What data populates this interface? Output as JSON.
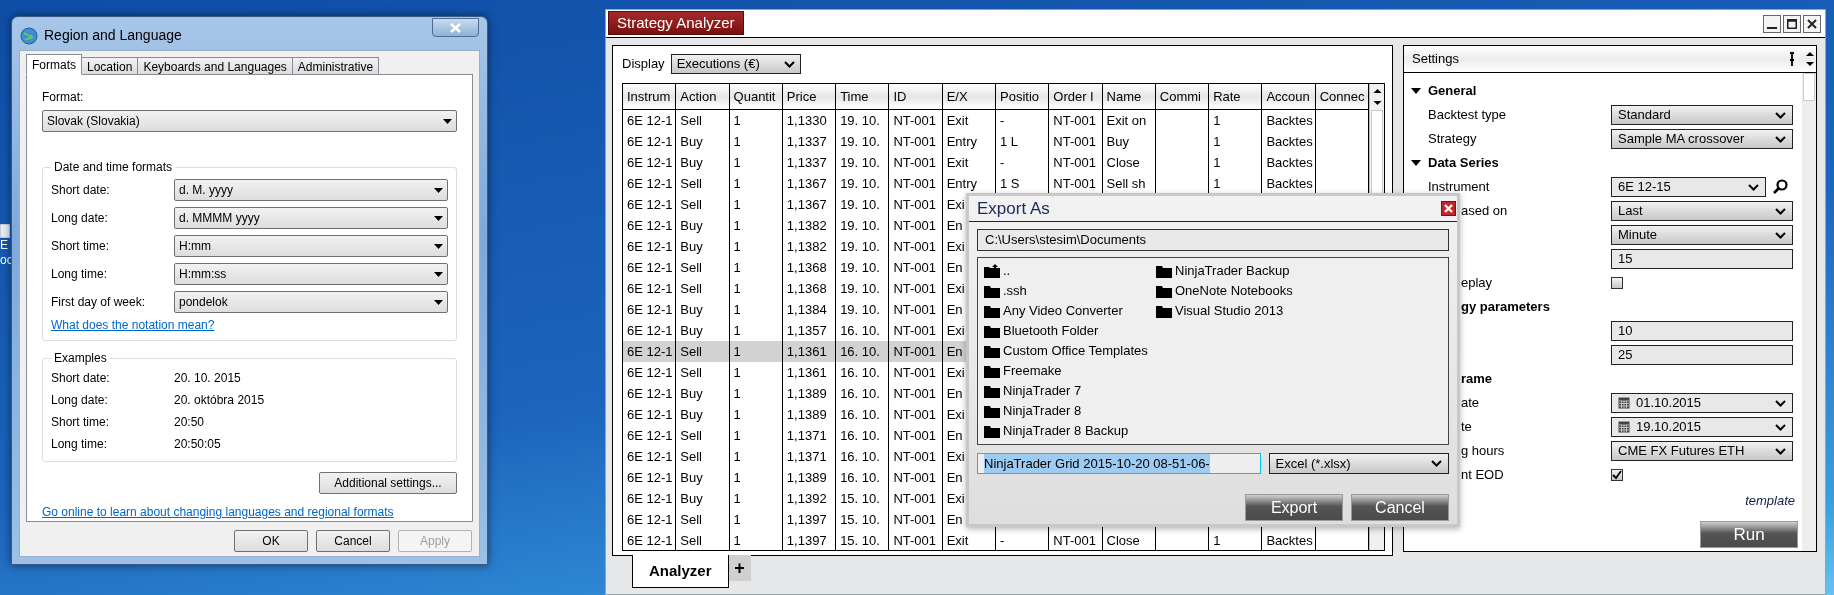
{
  "desktop": {
    "icon_label_lines": [
      "E",
      "oc"
    ]
  },
  "region_dialog": {
    "title": "Region and Language",
    "tabs": [
      {
        "label": "Formats",
        "selected": true
      },
      {
        "label": "Location",
        "selected": false
      },
      {
        "label": "Keyboards and Languages",
        "selected": false
      },
      {
        "label": "Administrative",
        "selected": false
      }
    ],
    "format_label": "Format:",
    "format_value": "Slovak (Slovakia)",
    "formats_group": {
      "title": "Date and time formats",
      "rows": [
        {
          "label": "Short date:",
          "value": "d. M. yyyy"
        },
        {
          "label": "Long date:",
          "value": "d. MMMM yyyy"
        },
        {
          "label": "Short time:",
          "value": "H:mm"
        },
        {
          "label": "Long time:",
          "value": "H:mm:ss"
        },
        {
          "label": "First day of week:",
          "value": "pondelok"
        }
      ],
      "link": "What does the notation mean?"
    },
    "examples_group": {
      "title": "Examples",
      "rows": [
        {
          "label": "Short date:",
          "value": "20. 10. 2015"
        },
        {
          "label": "Long date:",
          "value": "20. októbra 2015"
        },
        {
          "label": "Short time:",
          "value": "20:50"
        },
        {
          "label": "Long time:",
          "value": "20:50:05"
        }
      ]
    },
    "additional_button": "Additional settings...",
    "online_link": "Go online to learn about changing languages and regional formats",
    "buttons": [
      {
        "label": "OK",
        "disabled": false
      },
      {
        "label": "Cancel",
        "disabled": false
      },
      {
        "label": "Apply",
        "disabled": true
      }
    ]
  },
  "strategy_window": {
    "title": "Strategy Analyzer",
    "display_label": "Display",
    "display_value": "Executions (€)",
    "table": {
      "columns": [
        "Instrum",
        "Action",
        "Quantit",
        "Price",
        "Time",
        "ID",
        "E/X",
        "Positio",
        "Order I",
        "Name",
        "Commi",
        "Rate",
        "Accoun",
        "Connec"
      ],
      "rows": [
        {
          "selected": false,
          "cells": [
            "6E 12-1",
            "Sell",
            "1",
            "1,1330",
            "19. 10.",
            "NT-001",
            "Exit",
            "-",
            "NT-001",
            "Exit on",
            null,
            "1",
            "Backtes"
          ]
        },
        {
          "selected": false,
          "cells": [
            "6E 12-1",
            "Buy",
            "1",
            "1,1337",
            "19. 10.",
            "NT-001",
            "Entry",
            "1 L",
            "NT-001",
            "Buy",
            null,
            "1",
            "Backtes"
          ]
        },
        {
          "selected": false,
          "cells": [
            "6E 12-1",
            "Buy",
            "1",
            "1,1337",
            "19. 10.",
            "NT-001",
            "Exit",
            "-",
            "NT-001",
            "Close",
            null,
            "1",
            "Backtes"
          ]
        },
        {
          "selected": false,
          "cells": [
            "6E 12-1",
            "Sell",
            "1",
            "1,1367",
            "19. 10.",
            "NT-001",
            "Entry",
            "1 S",
            "NT-001",
            "Sell sh",
            null,
            "1",
            "Backtes"
          ]
        },
        {
          "selected": false,
          "cells": [
            "6E 12-1",
            "Sell",
            "1",
            "1,1367",
            "19. 10.",
            "NT-001",
            "Exi"
          ]
        },
        {
          "selected": false,
          "cells": [
            "6E 12-1",
            "Buy",
            "1",
            "1,1382",
            "19. 10.",
            "NT-001",
            "En"
          ]
        },
        {
          "selected": false,
          "cells": [
            "6E 12-1",
            "Buy",
            "1",
            "1,1382",
            "19. 10.",
            "NT-001",
            "Exi"
          ]
        },
        {
          "selected": false,
          "cells": [
            "6E 12-1",
            "Sell",
            "1",
            "1,1368",
            "19. 10.",
            "NT-001",
            "En"
          ]
        },
        {
          "selected": false,
          "cells": [
            "6E 12-1",
            "Sell",
            "1",
            "1,1368",
            "19. 10.",
            "NT-001",
            "Exi"
          ]
        },
        {
          "selected": false,
          "cells": [
            "6E 12-1",
            "Buy",
            "1",
            "1,1384",
            "19. 10.",
            "NT-001",
            "En"
          ]
        },
        {
          "selected": false,
          "cells": [
            "6E 12-1",
            "Buy",
            "1",
            "1,1357",
            "16. 10.",
            "NT-001",
            "Exi"
          ]
        },
        {
          "selected": true,
          "cells": [
            "6E 12-1",
            "Sell",
            "1",
            "1,1361",
            "16. 10.",
            "NT-001",
            "En"
          ]
        },
        {
          "selected": false,
          "cells": [
            "6E 12-1",
            "Sell",
            "1",
            "1,1361",
            "16. 10.",
            "NT-001",
            "Exi"
          ]
        },
        {
          "selected": false,
          "cells": [
            "6E 12-1",
            "Buy",
            "1",
            "1,1389",
            "16. 10.",
            "NT-001",
            "En"
          ]
        },
        {
          "selected": false,
          "cells": [
            "6E 12-1",
            "Buy",
            "1",
            "1,1389",
            "16. 10.",
            "NT-001",
            "Exi"
          ]
        },
        {
          "selected": false,
          "cells": [
            "6E 12-1",
            "Sell",
            "1",
            "1,1371",
            "16. 10.",
            "NT-001",
            "En"
          ]
        },
        {
          "selected": false,
          "cells": [
            "6E 12-1",
            "Sell",
            "1",
            "1,1371",
            "16. 10.",
            "NT-001",
            "Exi"
          ]
        },
        {
          "selected": false,
          "cells": [
            "6E 12-1",
            "Buy",
            "1",
            "1,1389",
            "16. 10.",
            "NT-001",
            "En"
          ]
        },
        {
          "selected": false,
          "cells": [
            "6E 12-1",
            "Buy",
            "1",
            "1,1392",
            "15. 10.",
            "NT-001",
            "Exi"
          ]
        },
        {
          "selected": false,
          "cells": [
            "6E 12-1",
            "Sell",
            "1",
            "1,1397",
            "15. 10.",
            "NT-001",
            "En"
          ]
        },
        {
          "selected": false,
          "cells": [
            "6E 12-1",
            "Sell",
            "1",
            "1,1397",
            "15. 10.",
            "NT-001",
            "Exit",
            "-",
            "NT-001",
            "Close",
            null,
            "1",
            "Backtes"
          ]
        }
      ]
    },
    "tabs": [
      {
        "label": "Analyzer",
        "selected": true
      }
    ],
    "add_tab": "+",
    "settings": {
      "title": "Settings",
      "items": [
        {
          "kind": "category",
          "label": "General",
          "expanded": true
        },
        {
          "kind": "select",
          "label": "Backtest type",
          "value": "Standard"
        },
        {
          "kind": "select",
          "label": "Strategy",
          "value": "Sample MA crossover"
        },
        {
          "kind": "category",
          "label": "Data Series",
          "expanded": true
        },
        {
          "kind": "instrument",
          "label": "Instrument",
          "value": "6E 12-15"
        },
        {
          "kind": "select",
          "label": "ased on",
          "value": "Last"
        },
        {
          "kind": "select",
          "value": "Minute"
        },
        {
          "kind": "text",
          "value": "15"
        },
        {
          "kind": "checkbox",
          "label": "eplay",
          "checked": false
        },
        {
          "kind": "category",
          "label": "gy parameters"
        },
        {
          "kind": "text",
          "value": "10"
        },
        {
          "kind": "text",
          "value": "25"
        },
        {
          "kind": "category",
          "label": "rame"
        },
        {
          "kind": "date",
          "label": "ate",
          "value": "01.10.2015"
        },
        {
          "kind": "date",
          "label": "te",
          "value": "19.10.2015"
        },
        {
          "kind": "select",
          "label": "g hours",
          "value": "CME FX Futures ETH"
        },
        {
          "kind": "checkbox",
          "label": "nt EOD",
          "checked": true
        }
      ],
      "template_link": "template",
      "run_button": "Run"
    }
  },
  "export_dialog": {
    "title": "Export As",
    "path": "C:\\Users\\stesim\\Documents",
    "folders": [
      {
        "kind": "up",
        "name": ".."
      },
      {
        "kind": "folder",
        "name": ".ssh"
      },
      {
        "kind": "folder",
        "name": "Any Video Converter"
      },
      {
        "kind": "folder",
        "name": "Bluetooth Folder"
      },
      {
        "kind": "folder",
        "name": "Custom Office Templates"
      },
      {
        "kind": "folder",
        "name": "Freemake"
      },
      {
        "kind": "folder",
        "name": "NinjaTrader 7"
      },
      {
        "kind": "folder",
        "name": "NinjaTrader 8"
      },
      {
        "kind": "folder",
        "name": "NinjaTrader 8 Backup"
      },
      {
        "kind": "folder",
        "name": "NinjaTrader Backup"
      },
      {
        "kind": "folder",
        "name": "OneNote Notebooks"
      },
      {
        "kind": "folder",
        "name": "Visual Studio 2013"
      }
    ],
    "filename": "NinjaTrader Grid 2015-10-20 08-51-06-",
    "format": "Excel (*.xlsx)",
    "buttons": [
      "Export",
      "Cancel"
    ]
  }
}
